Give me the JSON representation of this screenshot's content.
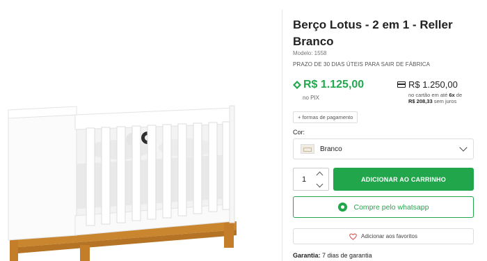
{
  "product": {
    "title": "Berço Lotus - 2 em 1 - Reller Branco",
    "model": "Modelo: 1558",
    "deadline": "PRAZO DE 30 DIAS ÚTEIS PARA SAIR DE FÁBRICA"
  },
  "pricing": {
    "pix_price": "R$ 1.125,00",
    "pix_label": "no PIX",
    "card_price": "R$ 1.250,00",
    "card_text_a": "no cartão em até ",
    "card_installments": "6x",
    "card_text_b": " de",
    "card_installment_value": "R$ 208,33",
    "card_text_c": " sem juros",
    "payment_forms_label": "+ formas de pagamento"
  },
  "variant": {
    "label": "Cor:",
    "selected": "Branco"
  },
  "cart": {
    "quantity": "1",
    "add_to_cart_label": "ADICIONAR AO CARRINHO"
  },
  "whatsapp": {
    "label": "Compre pelo whatsapp"
  },
  "favorites": {
    "label": "Adicionar aos favoritos"
  },
  "warranty": {
    "label": "Garantia:",
    "value": " 7 dias de garantia"
  },
  "icons": {
    "pix": "pix-icon",
    "card": "credit-card-icon",
    "whatsapp": "whatsapp-icon",
    "heart": "heart-icon",
    "chevron": "chevron-down-icon"
  },
  "colors": {
    "accent_green": "#21a64b",
    "pix_green": "#23a84f",
    "border": "#dddddd"
  }
}
